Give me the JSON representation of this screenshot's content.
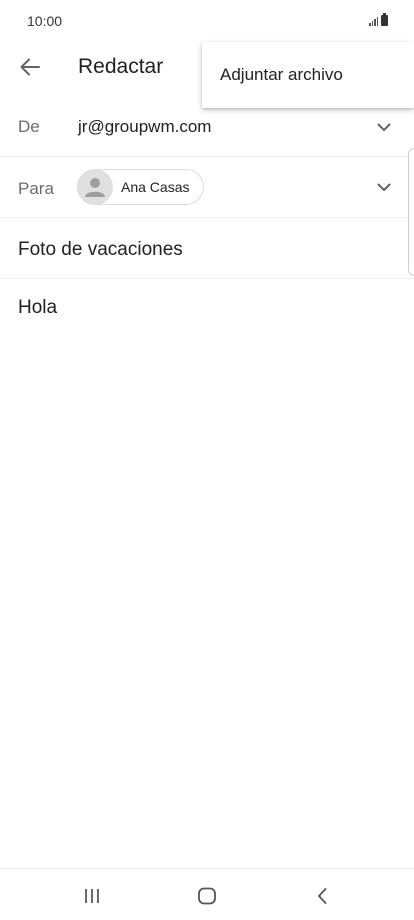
{
  "status_bar": {
    "time": "10:00"
  },
  "app_bar": {
    "title": "Redactar"
  },
  "overflow_menu": {
    "items": [
      {
        "label": "Adjuntar archivo"
      }
    ]
  },
  "compose": {
    "from": {
      "label": "De",
      "value": "jr@groupwm.com"
    },
    "to": {
      "label": "Para",
      "recipients": [
        {
          "name": "Ana Casas"
        }
      ]
    },
    "subject": "Foto de vacaciones",
    "body": "Hola"
  },
  "icons": {
    "back": "arrow-back-icon",
    "expand": "chevron-down-icon",
    "avatar": "person-icon",
    "nav_recents": "recents-icon",
    "nav_home": "home-icon",
    "nav_back": "nav-back-icon"
  },
  "colors": {
    "label": "#6b6b6b",
    "text": "#202124",
    "divider": "#eceff1"
  }
}
